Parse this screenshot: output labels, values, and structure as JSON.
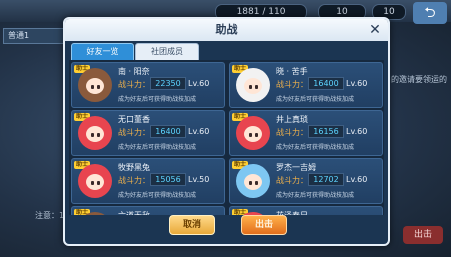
{
  "hud": {
    "stamina": "1881 / 110",
    "resource2": "10",
    "resource3": "10"
  },
  "background": {
    "left_tab": "普通1",
    "right_text": "的邀请要领运的",
    "bottom_left_text": "注意：1",
    "bottom_right_button": "出击"
  },
  "modal": {
    "title": "助战",
    "tabs": [
      {
        "label": "好友一览",
        "active": true
      },
      {
        "label": "社团成员",
        "active": false
      }
    ],
    "power_label": "战斗力：",
    "cards": [
      {
        "badge": "助士",
        "name": "南 · 阳奈",
        "power": "22350",
        "level": "Lv.60",
        "desc": "成为好友后可获得助战技加成",
        "hair": "#8a5a3c"
      },
      {
        "badge": "助士",
        "name": "晓 · 苦手",
        "power": "16400",
        "level": "Lv.60",
        "desc": "成为好友后可获得助战技加成",
        "hair": "#f2f2f2"
      },
      {
        "badge": "助士",
        "name": "无口董香",
        "power": "16400",
        "level": "Lv.60",
        "desc": "成为好友后可获得助战技加成",
        "hair": "#e8454f"
      },
      {
        "badge": "助士",
        "name": "井上真琐",
        "power": "16156",
        "level": "Lv.60",
        "desc": "成为好友后可获得助战技加成",
        "hair": "#e8454f"
      },
      {
        "badge": "助士",
        "name": "牧野黑兔",
        "power": "15056",
        "level": "Lv.50",
        "desc": "成为好友后可获得助战技加成",
        "hair": "#e8454f"
      },
      {
        "badge": "助士",
        "name": "罗杰一吉姆",
        "power": "12702",
        "level": "Lv.60",
        "desc": "成为好友后可获得助战技加成",
        "hair": "#7ec7f2"
      },
      {
        "badge": "助士",
        "name": "六道无敌",
        "power": "",
        "level": "",
        "desc": "",
        "hair": "#8a5a3c"
      },
      {
        "badge": "助士",
        "name": "花泽春日",
        "power": "",
        "level": "",
        "desc": "",
        "hair": "#e8454f"
      }
    ],
    "buttons": {
      "cancel": "取消",
      "go": "出击"
    }
  }
}
